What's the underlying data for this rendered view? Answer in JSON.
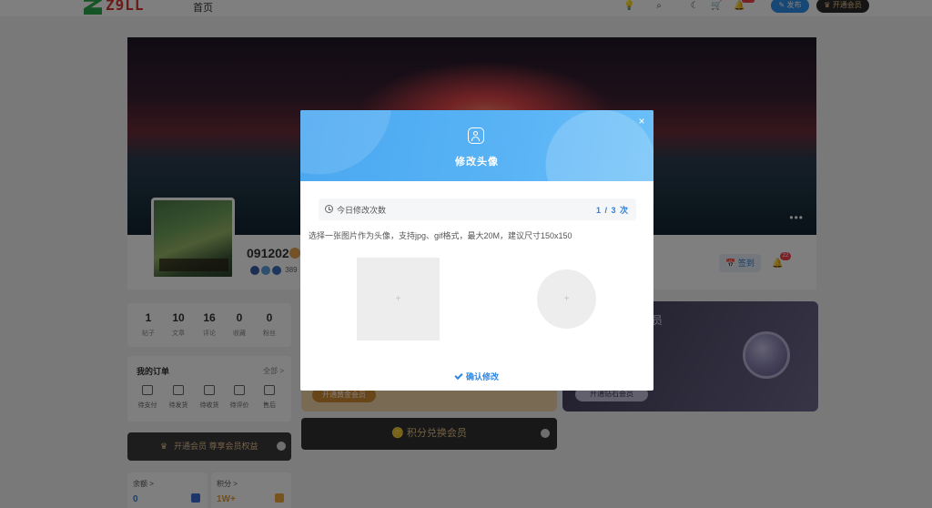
{
  "topbar": {
    "logo_text": "Z9LL",
    "nav_home": "首页",
    "publish_label": "发布",
    "vip_label": "开通会员",
    "icons": [
      "lightbulb-icon",
      "search-icon",
      "moon-icon",
      "cart-icon",
      "bell-icon"
    ]
  },
  "banner": {
    "more": "•••"
  },
  "profile": {
    "username": "091202",
    "meta": "389",
    "checkin_label": "签到",
    "notify_count": "22"
  },
  "stats": [
    {
      "value": "1",
      "label": "帖子"
    },
    {
      "value": "10",
      "label": "文章"
    },
    {
      "value": "16",
      "label": "评论"
    },
    {
      "value": "0",
      "label": "收藏"
    },
    {
      "value": "0",
      "label": "粉丝"
    }
  ],
  "orders": {
    "title": "我的订单",
    "all": "全部 >",
    "items": [
      {
        "label": "待支付",
        "icon": "wallet-icon"
      },
      {
        "label": "待发货",
        "icon": "box-icon"
      },
      {
        "label": "待收货",
        "icon": "truck-icon"
      },
      {
        "label": "待评价",
        "icon": "comment-icon"
      },
      {
        "label": "售后",
        "icon": "refund-icon"
      }
    ]
  },
  "vip_strip": {
    "label": "开通会员 尊享会员权益"
  },
  "balance": {
    "title": "余额 >",
    "value": "0"
  },
  "points": {
    "title": "积分 >",
    "value": "1W+"
  },
  "gold_card": {
    "button": "开通黄金会员"
  },
  "diamond_card": {
    "title": "员",
    "button": "开通钻石会员"
  },
  "points_card": {
    "label": "积分兑换会员"
  },
  "modal": {
    "title": "修改头像",
    "close": "×",
    "limit_label": "今日修改次数",
    "limit_count": "1 / 3 次",
    "hint": "选择一张图片作为头像，支持jpg、gif格式，最大20M，建议尺寸150x150",
    "plus": "+",
    "confirm": "确认修改"
  },
  "colors": {
    "accent": "#2f86e0",
    "header_gradient_start": "#4ba8f0",
    "header_gradient_end": "#6cc0f8",
    "overlay": "rgba(0,0,0,0.5)"
  }
}
